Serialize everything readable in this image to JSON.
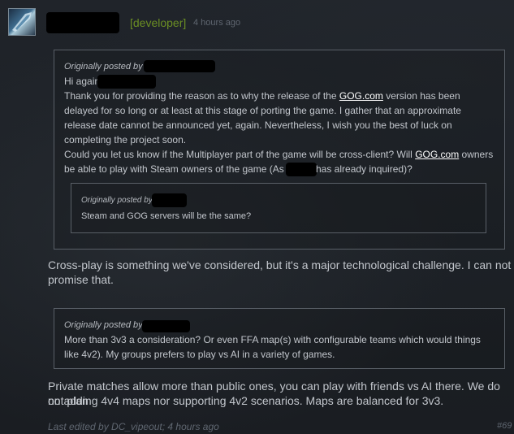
{
  "post": {
    "author_role": "[developer]",
    "time": "4 hours ago",
    "quote1": {
      "header": "Originally posted by",
      "line1": "Hi again",
      "line2a": "Thank you for providing the reason as to why the release of the ",
      "link": "GOG.com",
      "line2b": " version has been",
      "line3": "delayed for so long or at least at this stage of porting the game. I gather that an approximate",
      "line4": "release date cannot be announced yet, again. Nevertheless, I wish you the best of luck on",
      "line5": "completing the project soon.",
      "line6a": "Could you let us know if the Multiplayer part of the game will be cross-client? Will ",
      "line6b": " owners",
      "line7a": "be able to play with Steam owners of the game (As",
      "line7b": "has already inquired)?",
      "inner": {
        "header": "Originally posted by",
        "text": "Steam and GOG servers will be the same?"
      }
    },
    "reply1": {
      "line1": "Cross-play is something we've considered, but it's a major technological challenge. I can not",
      "line2": "promise that."
    },
    "quote2": {
      "header": "Originally posted by",
      "line1": "More than 3v3 a consideration? Or even FFA map(s) with configurable teams which would things",
      "line2": "like 4v2). My groups prefers to play vs AI in a variety of games."
    },
    "reply2": {
      "line1": "Private matches allow more than public ones, you can play with friends vs AI there. We do not plan",
      "line2": "on adding 4v4 maps nor supporting 4v2 scenarios. Maps are balanced for 3v3."
    },
    "footer": {
      "edited": "Last edited by DC_vipeout; 4 hours ago",
      "post_number": "#69"
    }
  },
  "colors": {
    "developer_tag": "#6b8e23",
    "text": "#c2c6cc",
    "muted": "#5f6670",
    "quote_border": "#595f67"
  }
}
